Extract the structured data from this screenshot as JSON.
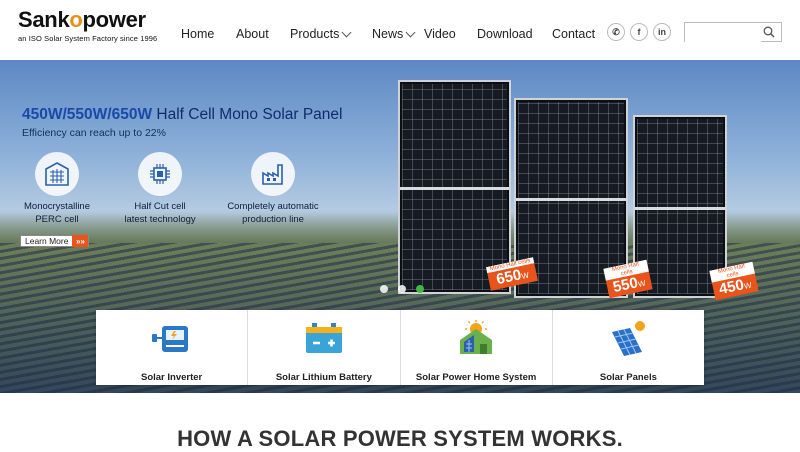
{
  "header": {
    "logo_name_part1": "Sank",
    "logo_name_o": "o",
    "logo_name_part2": "power",
    "logo_tagline": "an ISO Solar System Factory since 1996",
    "nav": [
      {
        "label": "Home"
      },
      {
        "label": "About"
      },
      {
        "label": "Products"
      },
      {
        "label": "News"
      },
      {
        "label": "Video"
      },
      {
        "label": "Download"
      },
      {
        "label": "Contact"
      }
    ],
    "social": [
      {
        "icon": "whatsapp-icon",
        "glyph": "✆"
      },
      {
        "icon": "facebook-icon",
        "glyph": "f"
      },
      {
        "icon": "linkedin-icon",
        "glyph": "in"
      }
    ],
    "search_placeholder": ""
  },
  "hero": {
    "title_bold": "450W/550W/650W",
    "title_rest": " Half Cell Mono Solar Panel",
    "subtitle": "Efficiency can reach up to 22%",
    "features": [
      {
        "line1": "Monocrystalline",
        "line2": "PERC cell",
        "icon": "solar-cell-icon"
      },
      {
        "line1": "Half Cut cell",
        "line2": "latest technology",
        "icon": "chip-icon"
      },
      {
        "line1": "Completely automatic",
        "line2": "production line",
        "icon": "factory-icon"
      }
    ],
    "learn_more": "Learn More",
    "learn_more_arrow": "»»",
    "badges": [
      {
        "small": "Mono Half cells",
        "number": "650",
        "unit": "W"
      },
      {
        "small": "Mono Half cells",
        "number": "550",
        "unit": "W"
      },
      {
        "small": "Mono Half cells",
        "number": "450",
        "unit": "W"
      }
    ],
    "slides_total": 3,
    "slide_active": 3
  },
  "categories": [
    {
      "label": "Solar Inverter",
      "icon": "inverter-icon"
    },
    {
      "label": "Solar Lithium Battery",
      "icon": "battery-icon"
    },
    {
      "label": "Solar Power Home System",
      "icon": "solar-home-icon"
    },
    {
      "label": "Solar Panels",
      "icon": "solar-panel-icon"
    }
  ],
  "section_title": "HOW A SOLAR POWER SYSTEM WORKS.",
  "colors": {
    "brand_orange": "#e8541c",
    "logo_sun": "#e8901c",
    "title_blue": "#1a4aa8",
    "active_dot": "#43b64a"
  }
}
